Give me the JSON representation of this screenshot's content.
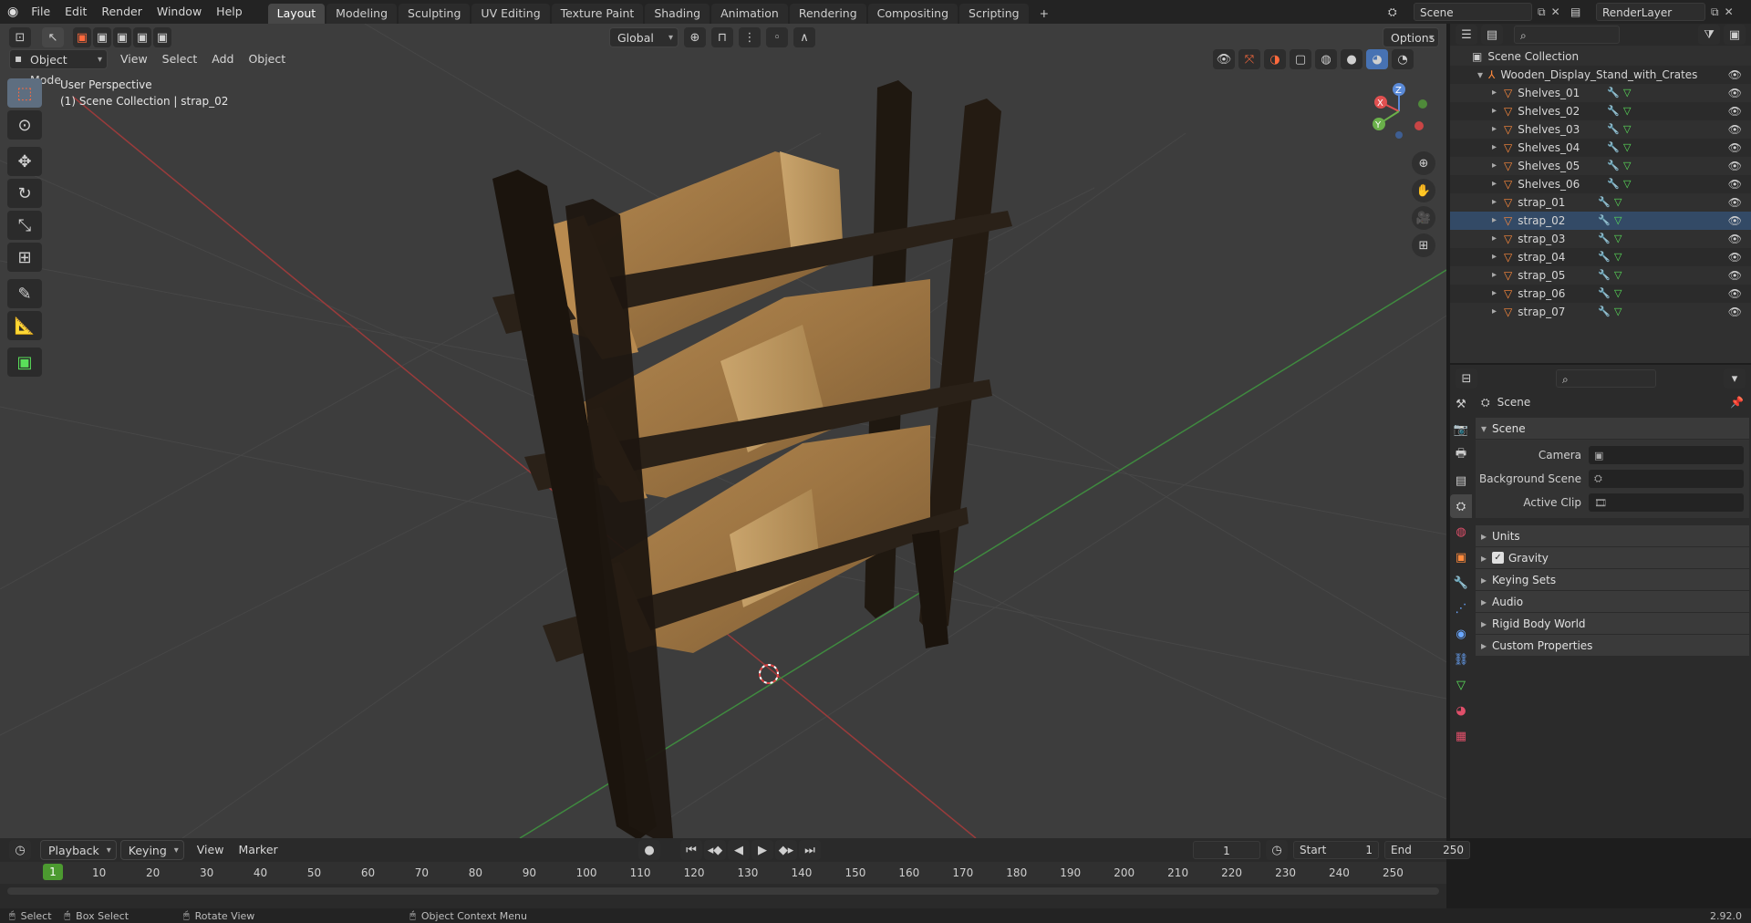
{
  "topbar": {
    "menus": [
      "File",
      "Edit",
      "Render",
      "Window",
      "Help"
    ],
    "workspaces": [
      "Layout",
      "Modeling",
      "Sculpting",
      "UV Editing",
      "Texture Paint",
      "Shading",
      "Animation",
      "Rendering",
      "Compositing",
      "Scripting"
    ],
    "active_workspace": "Layout",
    "add_tab": "+",
    "scene_name": "Scene",
    "view_layer": "RenderLayer"
  },
  "viewport": {
    "mode": "Object Mode",
    "menus": [
      "View",
      "Select",
      "Add",
      "Object"
    ],
    "transform_orientation": "Global",
    "options_label": "Options",
    "info_line1": "User Perspective",
    "info_line2": "(1) Scene Collection | strap_02",
    "gizmo_axes": {
      "x": "X",
      "y": "Y",
      "z": "Z"
    }
  },
  "outliner": {
    "root": "Scene Collection",
    "collection": "Wooden_Display_Stand_with_Crates",
    "objects": [
      "Shelves_01",
      "Shelves_02",
      "Shelves_03",
      "Shelves_04",
      "Shelves_05",
      "Shelves_06",
      "strap_01",
      "strap_02",
      "strap_03",
      "strap_04",
      "strap_05",
      "strap_06",
      "strap_07"
    ]
  },
  "properties": {
    "context": "Scene",
    "panel_title": "Scene",
    "camera_label": "Camera",
    "background_scene_label": "Background Scene",
    "active_clip_label": "Active Clip",
    "sub_panels": [
      "Units",
      "Gravity",
      "Keying Sets",
      "Audio",
      "Rigid Body World",
      "Custom Properties"
    ],
    "gravity_checked": true
  },
  "timeline": {
    "menus": [
      "Playback",
      "Keying",
      "View",
      "Marker"
    ],
    "current_frame": "1",
    "start_label": "Start",
    "start_value": "1",
    "end_label": "End",
    "end_value": "250",
    "ticks": [
      "1",
      "10",
      "20",
      "30",
      "40",
      "50",
      "60",
      "70",
      "80",
      "90",
      "100",
      "110",
      "120",
      "130",
      "140",
      "150",
      "160",
      "170",
      "180",
      "190",
      "200",
      "210",
      "220",
      "230",
      "240",
      "250"
    ]
  },
  "statusbar": {
    "select": "Select",
    "box_select": "Box Select",
    "rotate_view": "Rotate View",
    "context_menu": "Object Context Menu",
    "version": "2.92.0"
  },
  "colors": {
    "accent": "#4772b3",
    "object_icon": "#ff8a3c",
    "mesh_icon": "#5ae05a",
    "modifier_icon": "#6aa7ff",
    "frame_cursor": "#4c9a30"
  }
}
